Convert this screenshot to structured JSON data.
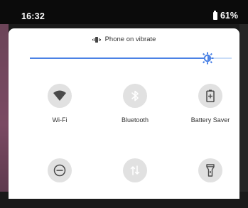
{
  "status_bar": {
    "time": "16:32",
    "battery_percent": "61%"
  },
  "ringer": {
    "icon": "vibrate-icon",
    "text": "Phone on vibrate"
  },
  "brightness": {
    "level": 0.88,
    "accent": "#4b82e5"
  },
  "tiles": [
    {
      "label": "Wi-Fi",
      "icon": "wifi-icon",
      "active": false
    },
    {
      "label": "Bluetooth",
      "icon": "bluetooth-icon",
      "active": true
    },
    {
      "label": "Battery Saver",
      "icon": "battery-saver-icon",
      "active": false
    },
    {
      "label": "",
      "icon": "do-not-disturb-icon",
      "active": false
    },
    {
      "label": "",
      "icon": "mobile-data-icon",
      "active": true
    },
    {
      "label": "",
      "icon": "flashlight-icon",
      "active": false
    }
  ],
  "colors": {
    "active_tile": "#4d85ee",
    "inactive_tile": "#e1e1e1"
  }
}
